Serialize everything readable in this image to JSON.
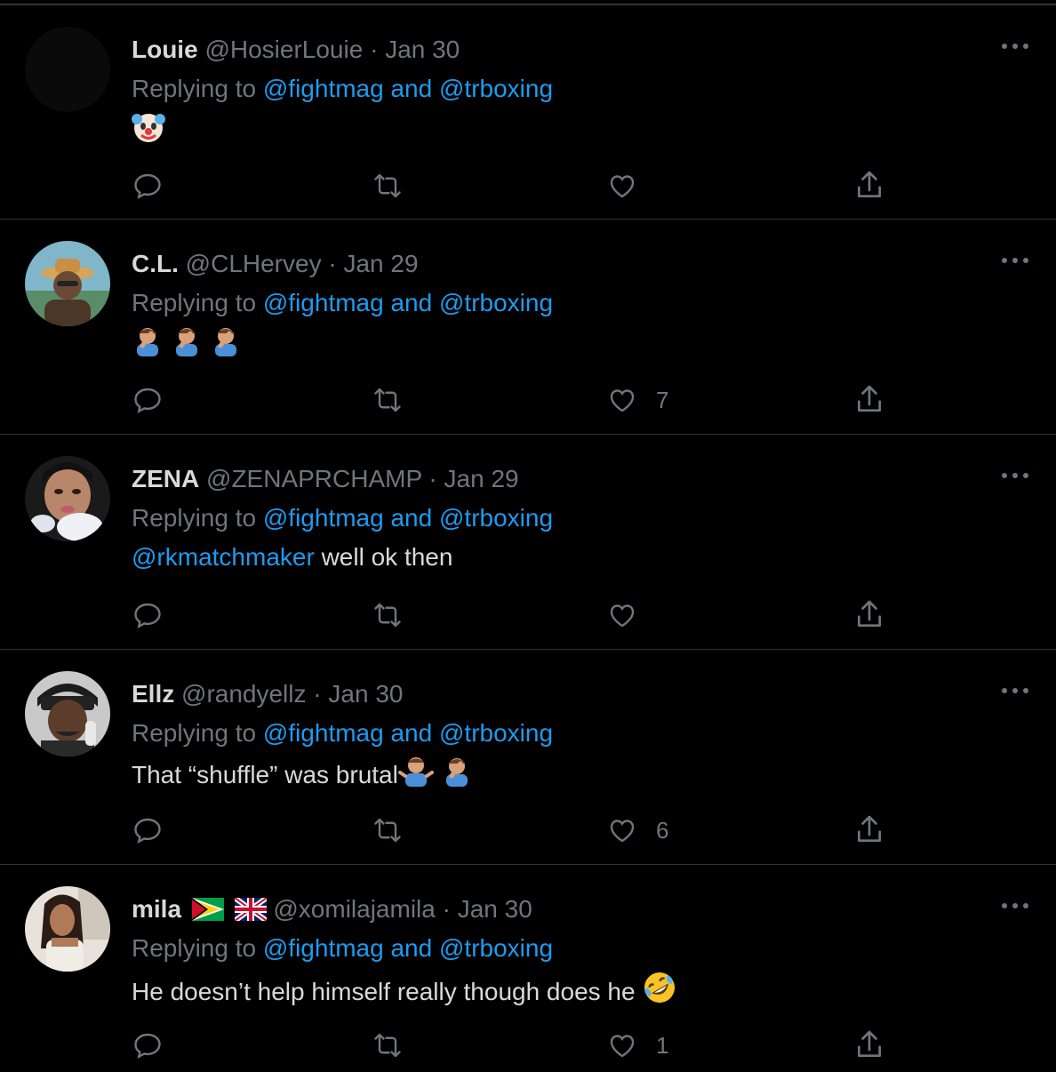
{
  "tweets": [
    {
      "name": "Louie",
      "handle": "@HosierLouie",
      "sep": "·",
      "date": "Jan 30",
      "replying_prefix": "Replying to",
      "reply_to_1": "@fightmag",
      "reply_and": "and",
      "reply_to_2": "@trboxing",
      "body_text": "",
      "like_count": "",
      "emojis": [
        "clown-face-emoji"
      ]
    },
    {
      "name": "C.L.",
      "handle": "@CLHervey",
      "sep": "·",
      "date": "Jan 29",
      "replying_prefix": "Replying to",
      "reply_to_1": "@fightmag",
      "reply_and": "and",
      "reply_to_2": "@trboxing",
      "body_text": "",
      "like_count": "7",
      "emojis": [
        "man-facepalming-emoji",
        "man-facepalming-emoji",
        "man-facepalming-emoji"
      ]
    },
    {
      "name": "ZENA",
      "handle": "@ZENAPRCHAMP",
      "sep": "·",
      "date": "Jan 29",
      "replying_prefix": "Replying to",
      "reply_to_1": "@fightmag",
      "reply_and": "and",
      "reply_to_2": "@trboxing",
      "body_mention": "@rkmatchmaker",
      "body_text": "well ok then",
      "like_count": ""
    },
    {
      "name": "Ellz",
      "handle": "@randyellz",
      "sep": "·",
      "date": "Jan 30",
      "replying_prefix": "Replying to",
      "reply_to_1": "@fightmag",
      "reply_and": "and",
      "reply_to_2": "@trboxing",
      "body_text": "That “shuffle” was brutal",
      "like_count": "6",
      "emojis": [
        "man-shrugging-emoji",
        "man-facepalming-emoji"
      ]
    },
    {
      "name": "mila",
      "handle": "@xomilajamila",
      "sep": "·",
      "date": "Jan 30",
      "replying_prefix": "Replying to",
      "reply_to_1": "@fightmag",
      "reply_and": "and",
      "reply_to_2": "@trboxing",
      "body_text": "He doesn’t help himself really though does he",
      "like_count": "1",
      "emojis": [
        "guyana-flag-emoji",
        "uk-flag-emoji",
        "rolling-laughing-emoji"
      ]
    }
  ],
  "colors": {
    "background": "#000000",
    "text_primary": "#d9d9d9",
    "text_secondary": "#6e767d",
    "link": "#1d9bf0",
    "divider": "#2f3336"
  },
  "icons": {
    "reply": "reply-icon",
    "retweet": "retweet-icon",
    "like": "like-icon",
    "share": "share-icon",
    "more": "more-icon"
  }
}
